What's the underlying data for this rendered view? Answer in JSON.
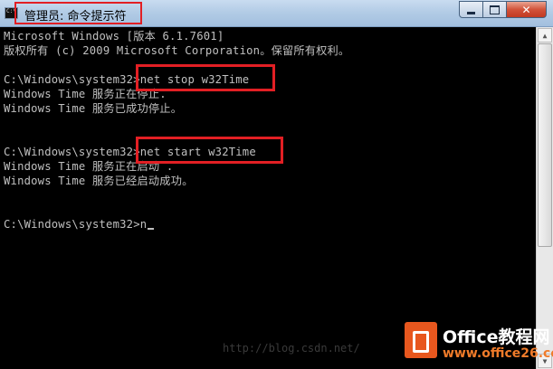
{
  "window": {
    "title": "管理员: 命令提示符",
    "icon_label": "C:\\",
    "buttons": {
      "minimize": "minimize-icon",
      "maximize": "maximize-icon",
      "close": "✕"
    }
  },
  "console": {
    "lines": [
      "Microsoft Windows [版本 6.1.7601]",
      "版权所有 (c) 2009 Microsoft Corporation。保留所有权利。",
      "",
      "C:\\Windows\\system32>net stop w32Time",
      "Windows Time 服务正在停止.",
      "Windows Time 服务已成功停止。",
      "",
      "",
      "C:\\Windows\\system32>net start w32Time",
      "Windows Time 服务正在启动 .",
      "Windows Time 服务已经启动成功。",
      "",
      "",
      "C:\\Windows\\system32>n"
    ],
    "highlighted_commands": [
      "net stop w32Time",
      "net start w32Time"
    ]
  },
  "watermark": {
    "url": "http://blog.csdn.net/",
    "brand_name": "Office教程网",
    "brand_url": "www.office26.com"
  },
  "colors": {
    "highlight": "#e21f24",
    "console_text": "#c0c0c0",
    "console_bg": "#000000"
  }
}
